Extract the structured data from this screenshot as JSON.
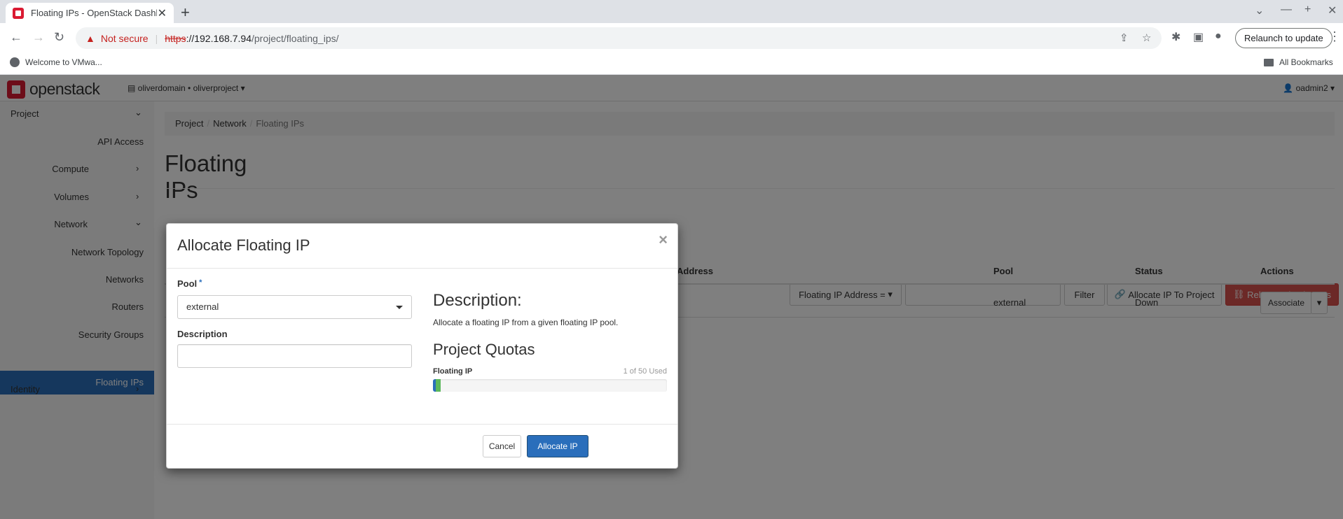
{
  "browser": {
    "tab_title": "Floating IPs - OpenStack Dashb",
    "not_secure": "Not secure",
    "url_proto": "https",
    "url_host": "://192.168.7.94",
    "url_path": "/project/floating_ips/",
    "relaunch": "Relaunch to update",
    "bookmark_1": "Welcome to VMwa...",
    "all_bookmarks": "All Bookmarks"
  },
  "header": {
    "logo_text": "openstack",
    "project_switch": "oliverdomain • oliverproject",
    "user": "oadmin2"
  },
  "sidebar": {
    "project": "Project",
    "api_access": "API Access",
    "compute": "Compute",
    "volumes": "Volumes",
    "network": "Network",
    "network_topology": "Network Topology",
    "networks": "Networks",
    "routers": "Routers",
    "security_groups": "Security Groups",
    "floating_ips": "Floating IPs",
    "identity": "Identity"
  },
  "breadcrumb": {
    "project": "Project",
    "network": "Network",
    "current": "Floating IPs"
  },
  "page_title": "Floating IPs",
  "filter": {
    "field": "Floating IP Address =",
    "filter_btn": "Filter",
    "allocate_btn": "Allocate IP To Project",
    "release_btn": "Release Floating IPs"
  },
  "table": {
    "columns": {
      "address": "Address",
      "pool": "Pool",
      "status": "Status",
      "actions": "Actions"
    },
    "rows": [
      {
        "pool": "external",
        "status": "Down",
        "action": "Associate"
      }
    ]
  },
  "modal": {
    "title": "Allocate Floating IP",
    "pool_label": "Pool",
    "pool_value": "external",
    "description_label": "Description",
    "description_value": "",
    "help_title": "Description:",
    "help_text": "Allocate a floating IP from a given floating IP pool.",
    "quota_title": "Project Quotas",
    "quota_label": "Floating IP",
    "quota_used_text": "1 of 50 Used",
    "quota_used": 1,
    "quota_total": 50,
    "cancel": "Cancel",
    "submit": "Allocate IP"
  },
  "colors": {
    "accent": "#2a6ebb",
    "danger": "#d9534f",
    "brand": "#da1a32"
  }
}
